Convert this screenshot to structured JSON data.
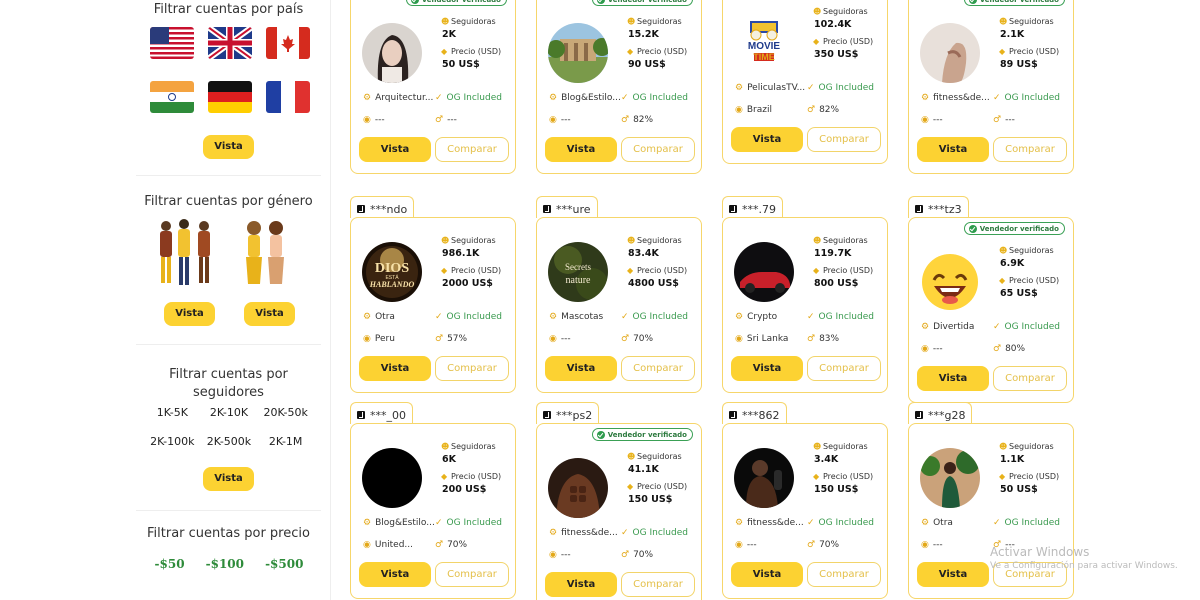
{
  "sidebar": {
    "country_title": "Filtrar cuentas por país",
    "country_vista": "Vista",
    "flags": [
      "usa-flag-icon",
      "uk-flag-icon",
      "canada-flag-icon",
      "india-flag-icon",
      "germany-flag-icon",
      "france-flag-icon"
    ],
    "gender_title": "Filtrar cuentas por género",
    "gender_vista_1": "Vista",
    "gender_vista_2": "Vista",
    "followers_title": "Filtrar cuentas por seguidores",
    "followers_ranges": [
      "1K-5K",
      "2K-10K",
      "20K-50k",
      "2K-100k",
      "2K-500k",
      "2K-1M"
    ],
    "followers_vista": "Vista",
    "price_title": "Filtrar cuentas por precio",
    "price_options": [
      "-$50",
      "-$100",
      "-$500"
    ]
  },
  "labels": {
    "seguidoras": "Seguidoras",
    "precio": "Precio (USD)",
    "vista": "Vista",
    "comparar": "Comparar",
    "verified": "Vendedor verificado",
    "og": "OG Included"
  },
  "cards": [
    {
      "handle": "",
      "followers": "2K",
      "price": "50 US$",
      "category": "Arquitectur...",
      "country": "---",
      "stat": "---",
      "verified": true
    },
    {
      "handle": "",
      "followers": "15.2K",
      "price": "90 US$",
      "category": "Blog&Estilo...",
      "country": "---",
      "stat": "82%",
      "verified": true
    },
    {
      "handle": "",
      "followers": "102.4K",
      "price": "350 US$",
      "category": "PeliculasTV...",
      "country": "Brazil",
      "stat": "82%",
      "verified": false
    },
    {
      "handle": "",
      "followers": "2.1K",
      "price": "89 US$",
      "category": "fitness&de...",
      "country": "---",
      "stat": "---",
      "verified": true
    },
    {
      "handle": "***ndo",
      "followers": "986.1K",
      "price": "2000 US$",
      "category": "Otra",
      "country": "Peru",
      "stat": "57%",
      "verified": false
    },
    {
      "handle": "***ure",
      "followers": "83.4K",
      "price": "4800 US$",
      "category": "Mascotas",
      "country": "---",
      "stat": "70%",
      "verified": false
    },
    {
      "handle": "***.79",
      "followers": "119.7K",
      "price": "800 US$",
      "category": "Crypto",
      "country": "Sri Lanka",
      "stat": "83%",
      "verified": false
    },
    {
      "handle": "***tz3",
      "followers": "6.9K",
      "price": "65 US$",
      "category": "Divertida",
      "country": "---",
      "stat": "80%",
      "verified": true
    },
    {
      "handle": "***_00",
      "followers": "6K",
      "price": "200 US$",
      "category": "Blog&Estilo...",
      "country": "United...",
      "stat": "70%",
      "verified": false
    },
    {
      "handle": "***ps2",
      "followers": "41.1K",
      "price": "150 US$",
      "category": "fitness&de...",
      "country": "---",
      "stat": "70%",
      "verified": true
    },
    {
      "handle": "***862",
      "followers": "3.4K",
      "price": "150 US$",
      "category": "fitness&de...",
      "country": "---",
      "stat": "70%",
      "verified": false
    },
    {
      "handle": "***g28",
      "followers": "1.1K",
      "price": "50 US$",
      "category": "Otra",
      "country": "---",
      "stat": "---",
      "verified": false
    }
  ],
  "poster_lines": {
    "dios_1": "DIOS",
    "dios_2": "ESTÁ",
    "dios_3": "HABLANDO",
    "nature_1": "Secrets",
    "nature_2": "nature",
    "movie_1": "MOVIE",
    "movie_2": "TIME"
  },
  "watermark": {
    "line1": "Activar Windows",
    "line2": "Ve a Configuración para activar Windows."
  },
  "colors": {
    "accent": "#fcd232",
    "card_border": "#f6d66b",
    "green": "#3a9a4f"
  }
}
